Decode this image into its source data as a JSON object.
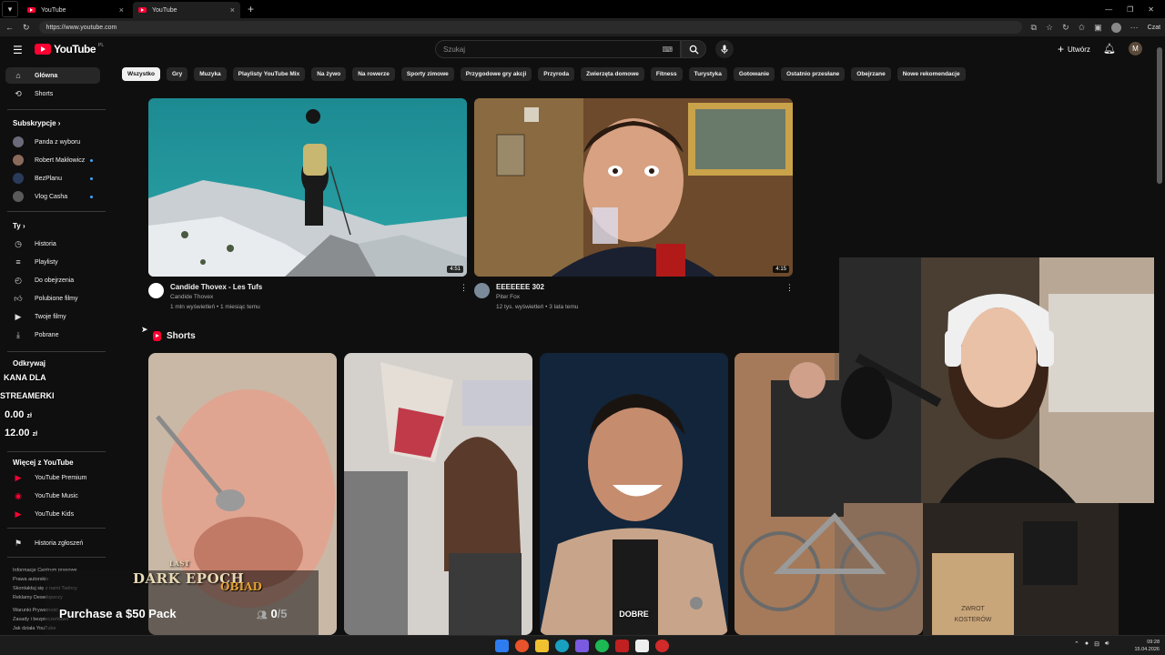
{
  "browser": {
    "tabs": [
      {
        "label": "YouTube",
        "close": "×"
      },
      {
        "label": "YouTube",
        "close": "×"
      }
    ],
    "new_tab": "+",
    "url": "https://www.youtube.com",
    "copilot_label": "Czat"
  },
  "masthead": {
    "logo_text": "YouTube",
    "country_code": "PL",
    "search_placeholder": "Szukaj",
    "create_label": "Utwórz",
    "account_initial": "M"
  },
  "sidebar": {
    "main": [
      {
        "label": "Główna",
        "icon": "home-icon"
      },
      {
        "label": "Shorts",
        "icon": "shorts-icon"
      }
    ],
    "subscriptions_header": "Subskrypcje",
    "subscriptions": [
      {
        "label": "Panda z wyboru"
      },
      {
        "label": "Robert Makłowicz"
      },
      {
        "label": "BezPlanu"
      },
      {
        "label": "Vlog Casha"
      }
    ],
    "you_header": "Ty",
    "you_items": [
      {
        "label": "Historia",
        "icon": "history-icon"
      },
      {
        "label": "Playlisty",
        "icon": "playlist-icon"
      },
      {
        "label": "Do obejrzenia",
        "icon": "clock-icon"
      },
      {
        "label": "Polubione filmy",
        "icon": "thumb-up-icon"
      },
      {
        "label": "Twoje filmy",
        "icon": "play-box-icon"
      },
      {
        "label": "Pobrane",
        "icon": "download-icon"
      }
    ],
    "explore_header": "Odkrywaj",
    "more_header": "Więcej z YouTube",
    "more_items": [
      {
        "label": "YouTube Premium"
      },
      {
        "label": "YouTube Music"
      },
      {
        "label": "YouTube Kids"
      }
    ],
    "report_history": "Historia zgłoszeń",
    "footer_lines": [
      "Informacje  Centrum prasowe",
      "Prawa autorskie",
      "Skontaktuj się z nami  Twórcy",
      "Reklamy  Deweloperzy",
      "",
      "Warunki  Prywatność",
      "Zasady i bezpieczeństwo",
      "Jak działa YouTube"
    ]
  },
  "chips": [
    "Wszystko",
    "Gry",
    "Muzyka",
    "Playlisty YouTube Mix",
    "Na żywo",
    "Na rowerze",
    "Sporty zimowe",
    "Przygodowe gry akcji",
    "Przyroda",
    "Zwierzęta domowe",
    "Fitness",
    "Turystyka",
    "Gotowanie",
    "Ostatnio przesłane",
    "Obejrzane",
    "Nowe rekomendacje"
  ],
  "videos": [
    {
      "title": "Candide Thovex - Les Tufs",
      "channel": "Candide Thovex",
      "meta": "1 mln wyświetleń • 1 miesiąc temu",
      "duration": "4:51"
    },
    {
      "title": "EEEEEEE 302",
      "channel": "Piter Fox",
      "meta": "12 tys. wyświetleń • 3 lata temu",
      "duration": "4:15"
    }
  ],
  "shorts": {
    "header": "Shorts",
    "items": [
      {
        "caption": ""
      },
      {
        "caption": ""
      },
      {
        "caption": "DOBRE"
      },
      {
        "caption": ""
      }
    ]
  },
  "stream_overlay": {
    "kana": "KANA DLA",
    "streamer": "STREAMERKI",
    "amount1": "0.00",
    "amount2": "12.00",
    "currency": "zł",
    "game_title": "DARK EPOCH",
    "game_prefix": "LAST",
    "game_sub": "OBIAD",
    "purchase": "Purchase a $50 Pack",
    "count": "0",
    "count_total": "/5"
  },
  "taskbar": {
    "time": "09:28",
    "date": "15.04.2026"
  }
}
